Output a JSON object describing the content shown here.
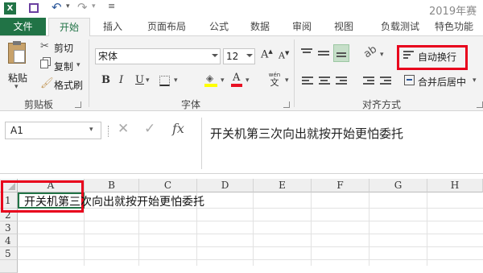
{
  "title_bar": {
    "title": "2019年赛福"
  },
  "tabs": [
    "文件",
    "开始",
    "插入",
    "页面布局",
    "公式",
    "数据",
    "审阅",
    "视图",
    "负载测试",
    "特色功能"
  ],
  "clipboard": {
    "paste": "粘贴",
    "cut": "剪切",
    "copy": "复制",
    "format_painter": "格式刷",
    "group_label": "剪贴板"
  },
  "font": {
    "family": "宋体",
    "size": "12",
    "group_label": "字体",
    "phonetic": "wén"
  },
  "alignment": {
    "wrap_text": "自动换行",
    "merge_center": "合并后居中",
    "group_label": "对齐方式"
  },
  "formula_bar": {
    "name_box": "A1",
    "fx": "fx",
    "content": "开关机第三次向出就按开始更怕委托"
  },
  "columns": [
    "A",
    "B",
    "C",
    "D",
    "E",
    "F",
    "G",
    "H"
  ],
  "rows": [
    "1",
    "2",
    "3",
    "4",
    "5"
  ],
  "cells": {
    "A1": "开关机第三次向出就按开始更怕委托"
  },
  "colors": {
    "brand": "#217346",
    "highlight": "#e8001c",
    "fill_yellow": "#ffff00",
    "font_red": "#e81123"
  }
}
